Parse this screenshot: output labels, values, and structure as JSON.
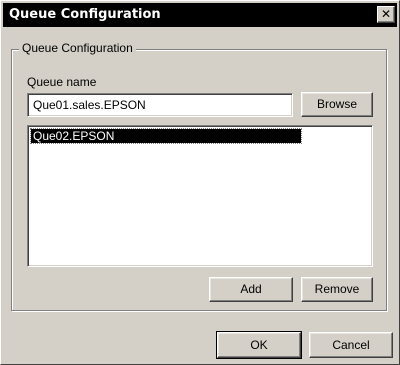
{
  "window": {
    "title": "Queue Configuration",
    "close_symbol": "✕"
  },
  "group": {
    "legend": "Queue Configuration"
  },
  "queue_name": {
    "label": "Queue name",
    "value": "Que01.sales.EPSON"
  },
  "buttons": {
    "browse": "Browse",
    "add": "Add",
    "remove": "Remove",
    "ok": "OK",
    "cancel": "Cancel"
  },
  "queue_list": {
    "items": [
      "Que02.EPSON"
    ],
    "selected_index": 0
  },
  "colors": {
    "titlebar": "#000000",
    "face": "#d4d0c8",
    "selection": "#000000"
  }
}
